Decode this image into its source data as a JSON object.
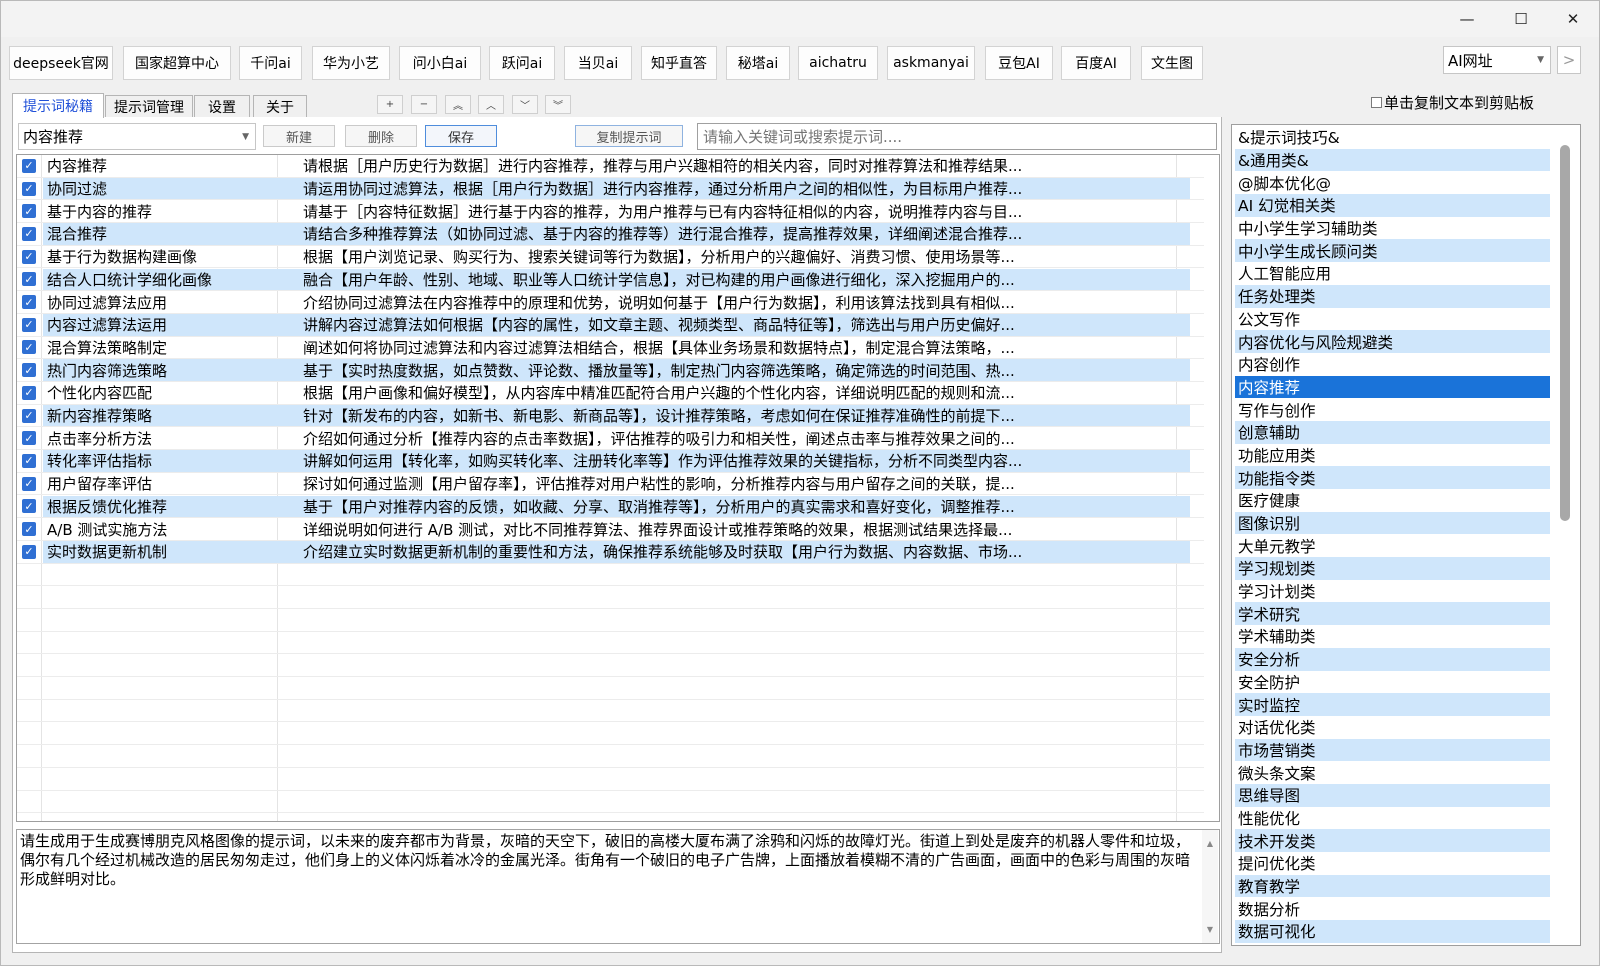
{
  "window": {
    "minimize": "—",
    "maximize": "☐",
    "close": "✕"
  },
  "top_buttons": [
    "deepseek官网",
    "国家超算中心",
    "千问ai",
    "华为小艺",
    "问小白ai",
    "跃问ai",
    "当贝ai",
    "知乎直答",
    "秘塔ai",
    "aichatru",
    "askmanyai",
    "豆包AI",
    "百度AI",
    "文生图"
  ],
  "url_combo": {
    "value": "AI网址",
    "next": ">"
  },
  "tabs": [
    "提示词秘籍",
    "提示词管理",
    "设置",
    "关于"
  ],
  "small_buttons": [
    "+",
    "−",
    "︽",
    "︿",
    "﹀",
    "︾"
  ],
  "copy_option": "单击复制文本到剪贴板",
  "category_combo": "内容推荐",
  "actions": {
    "new": "新建",
    "delete": "删除",
    "save": "保存",
    "copy": "复制提示词"
  },
  "search_placeholder": "请输入关键词或搜索提示词....",
  "rows": [
    {
      "title": "内容推荐",
      "content": "请根据［用户历史行为数据］进行内容推荐，推荐与用户兴趣相符的相关内容，同时对推荐算法和推荐结果..."
    },
    {
      "title": "协同过滤",
      "content": "请运用协同过滤算法，根据［用户行为数据］进行内容推荐，通过分析用户之间的相似性，为目标用户推荐..."
    },
    {
      "title": "基于内容的推荐",
      "content": "请基于［内容特征数据］进行基于内容的推荐，为用户推荐与已有内容特征相似的内容，说明推荐内容与目..."
    },
    {
      "title": "混合推荐",
      "content": "请结合多种推荐算法（如协同过滤、基于内容的推荐等）进行混合推荐，提高推荐效果，详细阐述混合推荐..."
    },
    {
      "title": "基于行为数据构建画像",
      "content": "根据【用户浏览记录、购买行为、搜索关键词等行为数据】，分析用户的兴趣偏好、消费习惯、使用场景等..."
    },
    {
      "title": "结合人口统计学细化画像",
      "content": "融合【用户年龄、性别、地域、职业等人口统计学信息】，对已构建的用户画像进行细化，深入挖掘用户的..."
    },
    {
      "title": "协同过滤算法应用",
      "content": "介绍协同过滤算法在内容推荐中的原理和优势，说明如何基于【用户行为数据】，利用该算法找到具有相似..."
    },
    {
      "title": "内容过滤算法运用",
      "content": "讲解内容过滤算法如何根据【内容的属性，如文章主题、视频类型、商品特征等】，筛选出与用户历史偏好..."
    },
    {
      "title": "混合算法策略制定",
      "content": "阐述如何将协同过滤算法和内容过滤算法相结合，根据【具体业务场景和数据特点】，制定混合算法策略，..."
    },
    {
      "title": "热门内容筛选策略",
      "content": "基于【实时热度数据，如点赞数、评论数、播放量等】，制定热门内容筛选策略，确定筛选的时间范围、热..."
    },
    {
      "title": "个性化内容匹配",
      "content": "根据【用户画像和偏好模型】，从内容库中精准匹配符合用户兴趣的个性化内容，详细说明匹配的规则和流..."
    },
    {
      "title": "新内容推荐策略",
      "content": "针对【新发布的内容，如新书、新电影、新商品等】，设计推荐策略，考虑如何在保证推荐准确性的前提下..."
    },
    {
      "title": "点击率分析方法",
      "content": "介绍如何通过分析【推荐内容的点击率数据】，评估推荐的吸引力和相关性，阐述点击率与推荐效果之间的..."
    },
    {
      "title": "转化率评估指标",
      "content": "讲解如何运用【转化率，如购买转化率、注册转化率等】作为评估推荐效果的关键指标，分析不同类型内容..."
    },
    {
      "title": "用户留存率评估",
      "content": "探讨如何通过监测【用户留存率】，评估推荐对用户粘性的影响，分析推荐内容与用户留存之间的关联，提..."
    },
    {
      "title": "根据反馈优化推荐",
      "content": "基于【用户对推荐内容的反馈，如收藏、分享、取消推荐等】，分析用户的真实需求和喜好变化，调整推荐..."
    },
    {
      "title": "A/B 测试实施方法",
      "content": "详细说明如何进行 A/B 测试，对比不同推荐算法、推荐界面设计或推荐策略的效果，根据测试结果选择最..."
    },
    {
      "title": "实时数据更新机制",
      "content": "介绍建立实时数据更新机制的重要性和方法，确保推荐系统能够及时获取【用户行为数据、内容数据、市场..."
    }
  ],
  "detail_text": "请生成用于生成赛博朋克风格图像的提示词，以未来的废弃都市为背景，灰暗的天空下，破旧的高楼大厦布满了涂鸦和闪烁的故障灯光。街道上到处是废弃的机器人零件和垃圾，偶尔有几个经过机械改造的居民匆匆走过，他们身上的义体闪烁着冰冷的金属光泽。街角有一个破旧的电子广告牌，上面播放着模糊不清的广告画面，画面中的色彩与周围的灰暗形成鲜明对比。",
  "categories": [
    "&提示词技巧&",
    "&通用类&",
    "@脚本优化@",
    "AI 幻觉相关类",
    "中小学生学习辅助类",
    "中小学生成长顾问类",
    "人工智能应用",
    "任务处理类",
    "公文写作",
    "内容优化与风险规避类",
    "内容创作",
    "内容推荐",
    "写作与创作",
    "创意辅助",
    "功能应用类",
    "功能指令类",
    "医疗健康",
    "图像识别",
    "大单元教学",
    "学习规划类",
    "学习计划类",
    "学术研究",
    "学术辅助类",
    "安全分析",
    "安全防护",
    "实时监控",
    "对话优化类",
    "市场营销类",
    "微头条文案",
    "思维导图",
    "性能优化",
    "技术开发类",
    "提问优化类",
    "教育教学",
    "数据分析",
    "数据可视化"
  ],
  "selected_category": "内容推荐",
  "colors": {
    "row_highlight": "#cfe6fb",
    "selected": "#1a73d9",
    "checkbox": "#2f6fd3",
    "active_tab": "#2050d8"
  }
}
